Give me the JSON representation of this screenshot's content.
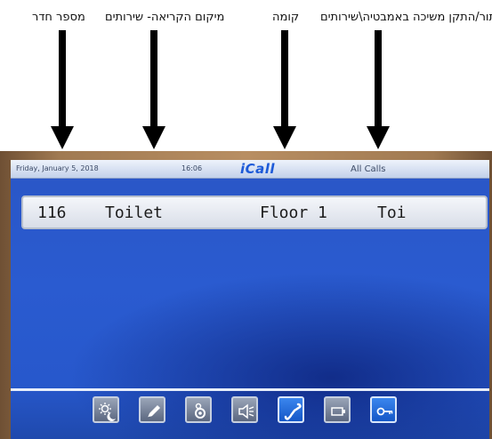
{
  "annotations": [
    {
      "id": "room-number",
      "text": "מספר חדר"
    },
    {
      "id": "call-location",
      "text": "מיקום הקריאה- שירותים"
    },
    {
      "id": "floor",
      "text": "קומה"
    },
    {
      "id": "bath-pull",
      "text": "כפתור/התקן משיכה באמבטיה\\שירותים"
    }
  ],
  "status_bar": {
    "date": "Friday, January 5, 2018",
    "time": "16:06",
    "brand": "iCall",
    "mode": "All Calls"
  },
  "call": {
    "room": "116",
    "location": "Toilet",
    "floor": "Floor 1",
    "type": "Toi"
  },
  "toolbar": {
    "icons": [
      "day-night-icon",
      "edit-pen-icon",
      "settings-gear-icon",
      "speaker-icon",
      "phone-icon",
      "video-display-icon",
      "key-icon"
    ],
    "active": [
      "phone-icon",
      "key-icon"
    ]
  },
  "colors": {
    "screen_blue": "#2a56c6",
    "active_button": "#1f6fe0",
    "bezel": "#a07a52"
  }
}
